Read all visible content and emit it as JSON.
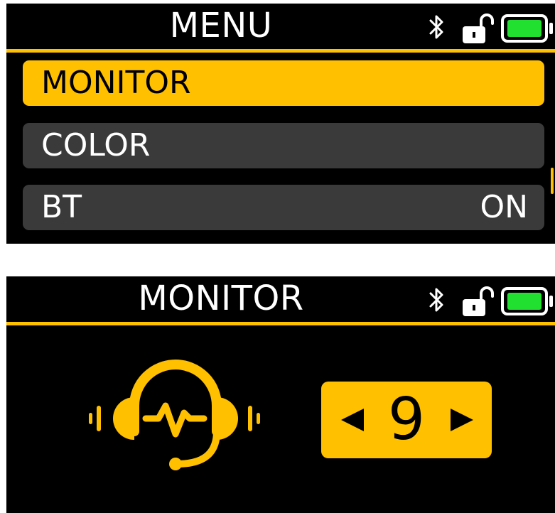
{
  "colors": {
    "accent": "#ffc000",
    "screen_bg": "#000000",
    "item_bg": "#3a3a3a",
    "battery_fill": "#22e02f"
  },
  "menu_screen": {
    "title": "MENU",
    "status_icons": [
      "bluetooth-icon",
      "unlocked-icon",
      "battery-icon"
    ],
    "items": [
      {
        "label": "MONITOR",
        "value": "",
        "selected": true
      },
      {
        "label": "COLOR",
        "value": "",
        "selected": false
      },
      {
        "label": "BT",
        "value": "ON",
        "selected": false
      }
    ]
  },
  "monitor_screen": {
    "title": "MONITOR",
    "status_icons": [
      "bluetooth-icon",
      "unlocked-icon",
      "battery-icon"
    ],
    "icon": "headset-heartbeat-icon",
    "value": "9"
  }
}
